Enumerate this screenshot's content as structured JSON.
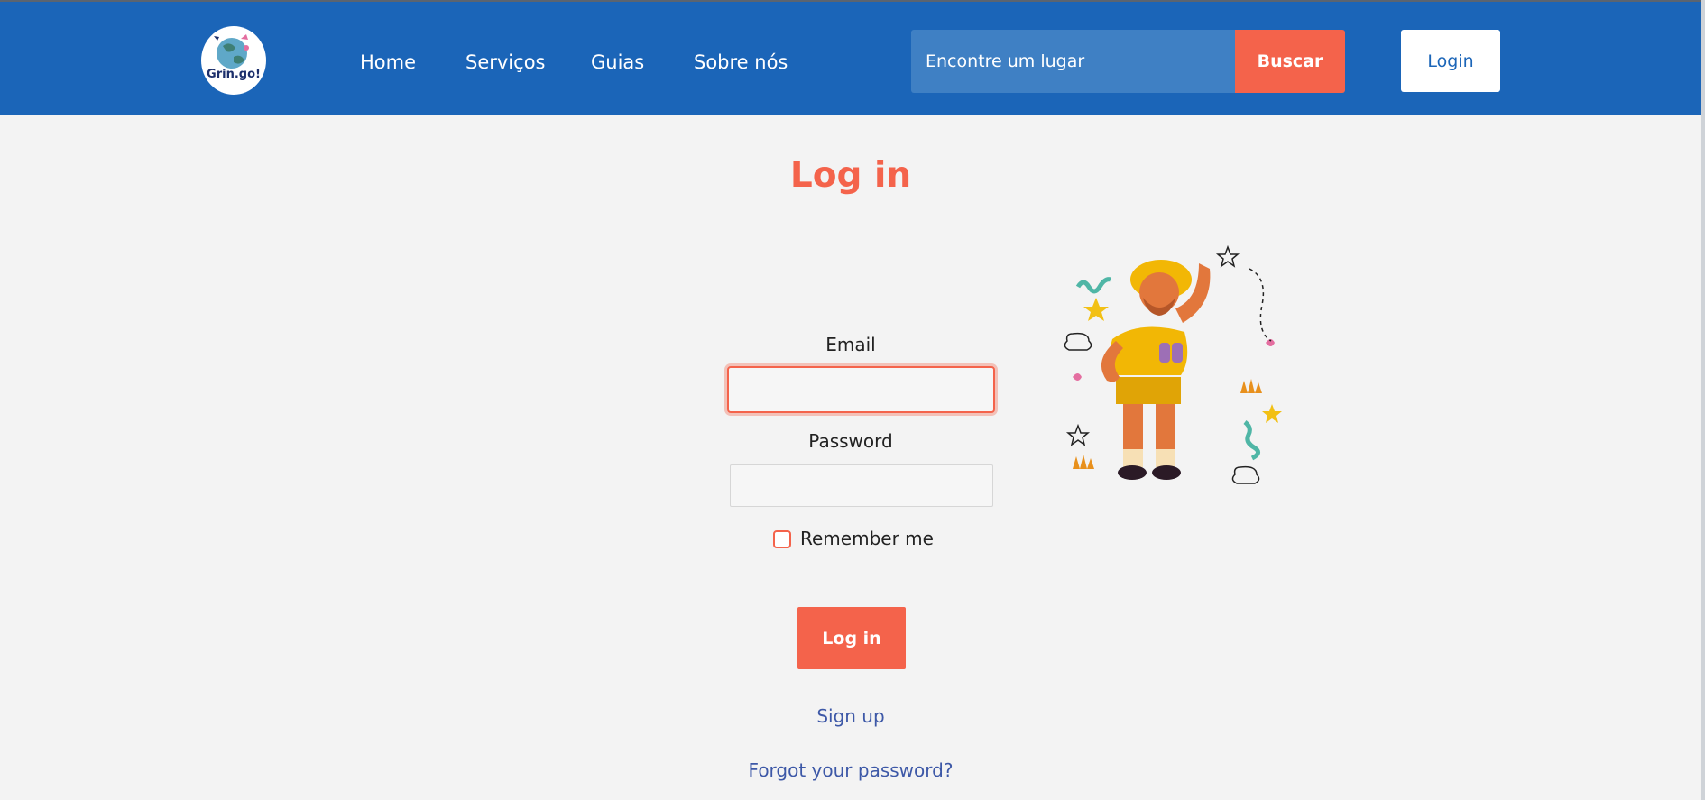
{
  "header": {
    "logo_text": "Grin.go!",
    "nav": [
      {
        "label": "Home"
      },
      {
        "label": "Serviços"
      },
      {
        "label": "Guias"
      },
      {
        "label": "Sobre nós"
      }
    ],
    "search": {
      "placeholder": "Encontre um lugar",
      "button_label": "Buscar"
    },
    "login_label": "Login"
  },
  "main": {
    "title": "Log in",
    "email_label": "Email",
    "email_value": "",
    "password_label": "Password",
    "password_value": "",
    "remember_label": "Remember me",
    "remember_checked": false,
    "submit_label": "Log in",
    "signup_label": "Sign up",
    "forgot_label": "Forgot your password?"
  },
  "illustration": {
    "icon": "explorer-illustration"
  },
  "colors": {
    "header_bg": "#1b65b8",
    "accent": "#f4634b",
    "search_bg": "#3f80c4",
    "link": "#3d58a7",
    "page_bg": "#f3f3f3"
  }
}
